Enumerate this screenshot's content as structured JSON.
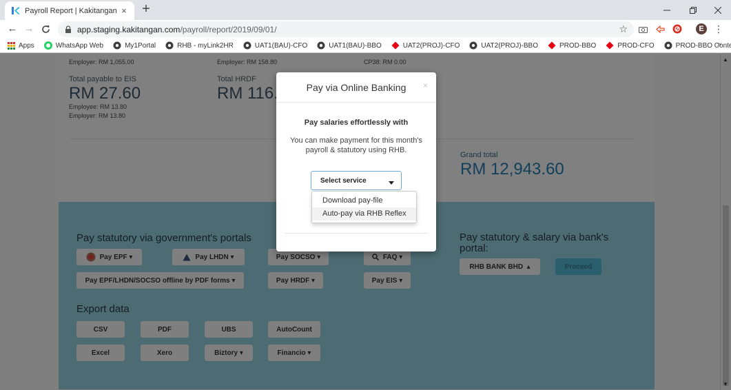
{
  "browser": {
    "tab_title": "Payroll Report | Kakitangan",
    "tab_close": "×",
    "new_tab": "+",
    "url_host": "app.staging.kakitangan.com",
    "url_path": "/payroll/report/2019/09/01/",
    "profile_initial": "E",
    "bookmarks": [
      "Apps",
      "WhatsApp Web",
      "My1Portal",
      "RHB - myLink2HR",
      "UAT1(BAU)-CFO",
      "UAT1(BAU)-BBO",
      "UAT2(PROJ)-CFO",
      "UAT2(PROJ)-BBO",
      "PROD-BBO",
      "PROD-CFO",
      "PROD-BBO Content..."
    ],
    "bookmarks_more": "»"
  },
  "summary": {
    "epf_employer": "Employer: RM 1,055.00",
    "hrdf_employer": "Employer: RM 158.80",
    "cp38": "CP38: RM 0.00",
    "eis_label": "Total payable to EIS",
    "eis_amount": "RM 27.60",
    "eis_employee": "Employee: RM 13.80",
    "eis_employer": "Employer: RM 13.80",
    "hrdf_label": "Total HRDF",
    "hrdf_amount": "RM 116.",
    "grand_total_label": "Grand total",
    "grand_total_amount": "RM 12,943.60"
  },
  "actions": {
    "gov_heading": "Pay statutory via government's portals",
    "bank_heading": "Pay statutory & salary via bank's portal:",
    "pay_epf": "Pay EPF",
    "pay_lhdn": "Pay LHDN",
    "pay_socso": "Pay SOCSO",
    "faq": "FAQ",
    "pay_offline": "Pay EPF/LHDN/SOCSO offline by PDF forms",
    "pay_hrdf": "Pay HRDF",
    "pay_eis": "Pay EIS",
    "bank_select": "RHB BANK BHD",
    "proceed": "Proceed",
    "export_heading": "Export data",
    "export_buttons": [
      "CSV",
      "PDF",
      "UBS",
      "AutoCount",
      "Excel",
      "Xero",
      "Biztory",
      "Financio"
    ]
  },
  "modal": {
    "title": "Pay via Online Banking",
    "close": "×",
    "heading": "Pay salaries effortlessly with",
    "body": "You can make payment for this month's payroll & statutory using RHB.",
    "select_label": "Select service",
    "options": [
      "Download pay-file",
      "Auto-pay via RHB Reflex"
    ]
  },
  "colors": {
    "overlay": "#7f7f7f",
    "teal_panel": "#4c6b72",
    "accent_blue": "#6fa8dc"
  }
}
